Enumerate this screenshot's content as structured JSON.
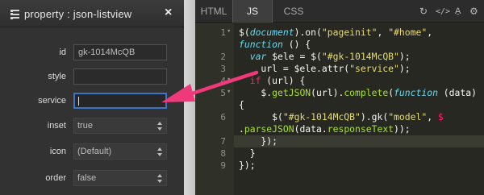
{
  "property_panel": {
    "title": "property : json-listview",
    "close_glyph": "×",
    "fields": [
      {
        "label": "id",
        "value": "gk-1014McQB",
        "kind": "input"
      },
      {
        "label": "style",
        "value": "",
        "kind": "input"
      },
      {
        "label": "service",
        "value": "",
        "kind": "input-focused"
      },
      {
        "label": "inset",
        "value": "true",
        "kind": "select"
      },
      {
        "label": "icon",
        "value": "(Default)",
        "kind": "select"
      },
      {
        "label": "order",
        "value": "false",
        "kind": "select"
      }
    ]
  },
  "editor": {
    "tabs": [
      {
        "label": "HTML",
        "active": false
      },
      {
        "label": "JS",
        "active": true
      },
      {
        "label": "CSS",
        "active": false
      }
    ],
    "toolbar_icons": [
      "refresh-icon",
      "code-icon",
      "font-size-icon",
      "settings-icon"
    ],
    "line_numbers": [
      "1",
      "2",
      "3",
      "4",
      "5",
      "6",
      "7",
      "8",
      "9"
    ]
  },
  "colors": {
    "accent": "#f0397a",
    "focus_border": "#3b74c6",
    "code_bg": "#272822"
  }
}
